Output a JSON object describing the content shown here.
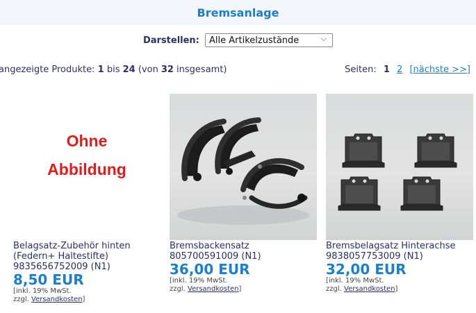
{
  "header": {
    "title": "Bremsanlage"
  },
  "filter": {
    "label": "Darstellen:",
    "selected": "Alle Artikelzustände"
  },
  "results": {
    "prefix": "angezeigte Produkte:",
    "from": "1",
    "bis": "bis",
    "to": "24",
    "von": "(von",
    "total": "32",
    "suffix": "insgesamt)"
  },
  "pagination": {
    "label": "Seiten:",
    "current": "1",
    "page2": "2",
    "next": "[nächste >>]"
  },
  "products": [
    {
      "no_image_line1": "Ohne",
      "no_image_line2": "Abbildung",
      "name_line1": "Belagsatz-Zubehör hinten",
      "name_line2": "(Federn+ Haltestifte)",
      "article": "9835656752009 (N1)",
      "price": "8,50 EUR",
      "tax": "[inkl. 19% MwSt.",
      "shipping_prefix": "zzgl.",
      "shipping_link": "Versandkosten",
      "shipping_suffix": "]"
    },
    {
      "image_icon": "brake-shoes-photo",
      "name_line1": "Bremsbackensatz",
      "article": "805700591009 (N1)",
      "price": "36,00 EUR",
      "tax": "[inkl. 19% MwSt.",
      "shipping_prefix": "zzgl.",
      "shipping_link": "Versandkosten",
      "shipping_suffix": "]"
    },
    {
      "image_icon": "brake-pads-photo",
      "name_line1": "Bremsbelagsatz Hinterachse",
      "article": "9838057753009 (N1)",
      "price": "32,00 EUR",
      "tax": "[inkl. 19% MwSt.",
      "shipping_prefix": "zzgl.",
      "shipping_link": "Versandkosten",
      "shipping_suffix": "]"
    }
  ],
  "colors": {
    "accent": "#1b7fd0",
    "navy": "#2b2f6a",
    "no_image_red": "#e31b1b"
  }
}
